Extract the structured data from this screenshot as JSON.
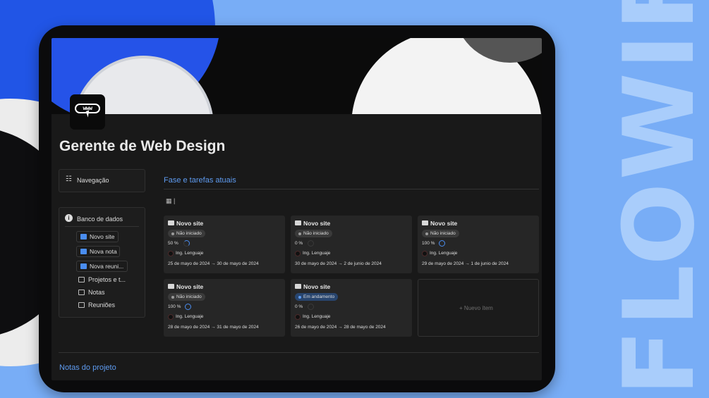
{
  "watermark": "FLOWIFY",
  "page": {
    "icon": "www-cursor-icon",
    "icon_text": "www",
    "title": "Gerente de Web Design"
  },
  "sidebar": {
    "nav_label": "Navegação",
    "nav_icon": "stack-icon",
    "db_label": "Banco de dados",
    "db_icon": "info-icon",
    "buttons": [
      {
        "label": "Novo site",
        "icon": "monitor-icon"
      },
      {
        "label": "Nova nota",
        "icon": "note-icon"
      },
      {
        "label": "Nova reuni...",
        "icon": "calendar-icon"
      }
    ],
    "links": [
      {
        "label": "Projetos e t...",
        "icon": "monitor-icon"
      },
      {
        "label": "Notas",
        "icon": "note-icon"
      },
      {
        "label": "Reuniões",
        "icon": "calendar-icon"
      }
    ]
  },
  "main": {
    "section_title": "Fase e tarefas atuais",
    "view_icon": "gallery-view-icon",
    "cards": [
      {
        "title": "Novo site",
        "status": "Não iniciado",
        "progress": "50 %",
        "progress_value": 0.5,
        "owner": "Ing. Lenguaje",
        "dates": "25 de mayo de 2024 → 30 de mayo de 2024"
      },
      {
        "title": "Novo site",
        "status": "Não iniciado",
        "progress": "0 %",
        "progress_value": 0,
        "owner": "Ing. Lenguaje",
        "dates": "30 de mayo de 2024 → 2 de junio de 2024"
      },
      {
        "title": "Novo site",
        "status": "Não iniciado",
        "progress": "100 %",
        "progress_value": 1,
        "owner": "Ing. Lenguaje",
        "dates": "29 de mayo de 2024 → 1 de junio de 2024"
      },
      {
        "title": "Novo site",
        "status": "Não iniciado",
        "progress": "100 %",
        "progress_value": 1,
        "owner": "Ing. Lenguaje",
        "dates": "28 de mayo de 2024 → 31 de mayo de 2024"
      },
      {
        "title": "Novo site",
        "status": "Em andamento",
        "progress": "0 %",
        "progress_value": 0,
        "owner": "Ing. Lenguaje",
        "dates": "26 de mayo de 2024 → 28 de mayo de 2024"
      }
    ],
    "new_item_label": "+ Nuevo ítem",
    "notes_title": "Notas do projeto"
  },
  "colors": {
    "accent": "#5e9bf0",
    "status_not_started": "#3a3a3a",
    "status_in_progress": "#28456e",
    "ring_done": "#4a8df0"
  }
}
